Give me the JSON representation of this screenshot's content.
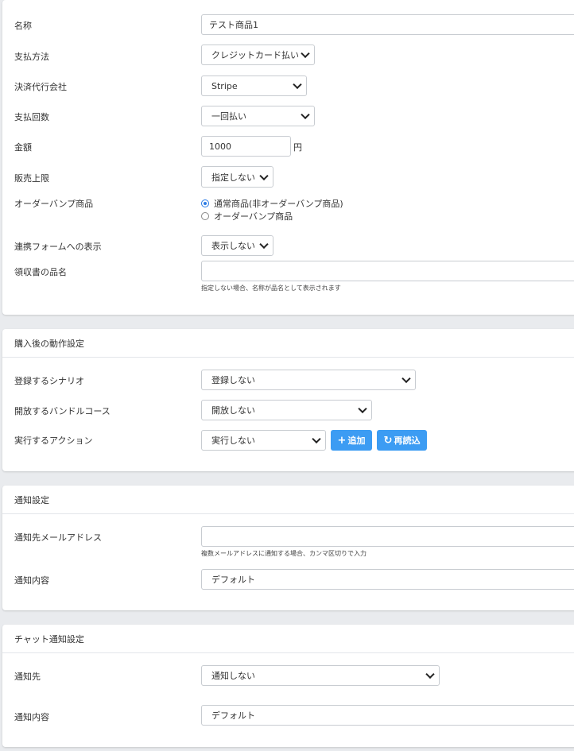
{
  "product": {
    "name_label": "名称",
    "name_value": "テスト商品1",
    "payment_method_label": "支払方法",
    "payment_method_value": "クレジットカード払い",
    "processor_label": "決済代行会社",
    "processor_value": "Stripe",
    "installments_label": "支払回数",
    "installments_value": "一回払い",
    "amount_label": "金額",
    "amount_value": "1000",
    "amount_unit": "円",
    "sales_limit_label": "販売上限",
    "sales_limit_value": "指定しない",
    "order_bump_label": "オーダーバンプ商品",
    "order_bump_options": [
      "通常商品(非オーダーバンプ商品)",
      "オーダーバンプ商品"
    ],
    "order_bump_selected": "通常商品(非オーダーバンプ商品)",
    "form_display_label": "連携フォームへの表示",
    "form_display_value": "表示しない",
    "receipt_name_label": "領収書の品名",
    "receipt_name_value": "",
    "receipt_name_help": "指定しない場合、名称が品名として表示されます"
  },
  "post_purchase": {
    "header": "購入後の動作設定",
    "scenario_label": "登録するシナリオ",
    "scenario_value": "登録しない",
    "bundle_label": "開放するバンドルコース",
    "bundle_value": "開放しない",
    "action_label": "実行するアクション",
    "action_value": "実行しない",
    "add_button": "追加",
    "reload_button": "再読込"
  },
  "notification": {
    "header": "通知設定",
    "email_label": "通知先メールアドレス",
    "email_value": "",
    "email_help": "複数メールアドレスに通知する場合、カンマ区切りで入力",
    "content_label": "通知内容",
    "content_value": "デフォルト"
  },
  "chat_notification": {
    "header": "チャット通知設定",
    "target_label": "通知先",
    "target_value": "通知しない",
    "content_label": "通知内容",
    "content_value": "デフォルト"
  },
  "colors": {
    "primary_button": "#3c9cf3",
    "page_background": "#e9ebee",
    "radio_checked": "#2b7be4"
  }
}
